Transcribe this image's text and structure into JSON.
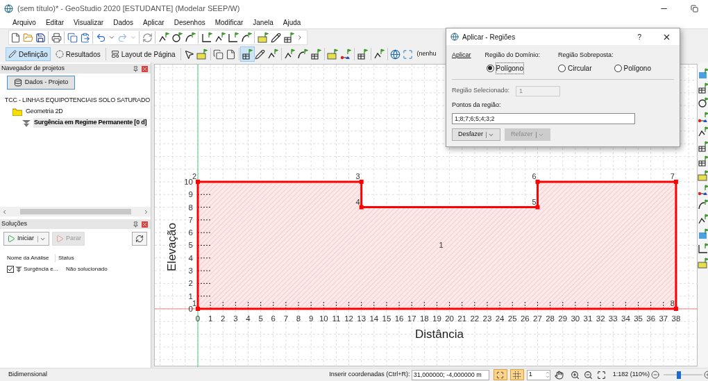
{
  "window": {
    "title": "(sem título)* - GeoStudio 2020 [ESTUDANTE] (Modelar SEEP/W)"
  },
  "menu": [
    "Arquivo",
    "Editar",
    "Visualizar",
    "Dados",
    "Aplicar",
    "Desenhos",
    "Modificar",
    "Janela",
    "Ajuda"
  ],
  "mode_tabs": [
    {
      "label": "Definição",
      "selected": true
    },
    {
      "label": "Resultados",
      "selected": false
    },
    {
      "label": "Layout de Página",
      "selected": false
    }
  ],
  "toolbar_text": "(nenhu",
  "project_navigator": {
    "title": "Navegador de projetos",
    "button": "Dados - Projeto",
    "tree": [
      {
        "label": "TCC - LINHAS EQUIPOTENCIAIS SOLO SATURADO",
        "selected": false,
        "children": [
          {
            "label": "Geometria 2D",
            "selected": false,
            "children": [
              {
                "label": "Surgência em Regime Permanente [0 d]",
                "selected": true
              }
            ]
          }
        ]
      }
    ]
  },
  "solutions": {
    "title": "Soluções",
    "buttons": [
      {
        "label": "Iniciar",
        "disabled": false
      },
      {
        "label": "Parar",
        "disabled": true
      }
    ],
    "columns": [
      "Nome da Análise",
      "Status"
    ],
    "rows": [
      {
        "checked": true,
        "name": "Surgência e...",
        "status": "Não solucionado"
      }
    ]
  },
  "canvas": {
    "chart_data": {
      "type": "area",
      "xlabel": "Distância",
      "ylabel": "Elevação",
      "x": [
        0,
        0,
        13,
        13,
        27,
        27,
        38,
        38,
        0
      ],
      "series": [
        {
          "color": "#ff0000",
          "values": [
            0,
            10,
            10,
            8,
            8,
            10,
            10,
            0,
            0
          ]
        }
      ],
      "xlim": [
        -3.42,
        39.77
      ],
      "ylim": [
        -4.59,
        19.23
      ],
      "grid": true,
      "xticks": [
        0,
        1,
        2,
        3,
        4,
        5,
        6,
        7,
        8,
        9,
        10,
        11,
        12,
        13,
        14,
        15,
        16,
        17,
        18,
        19,
        20,
        21,
        22,
        23,
        24,
        25,
        26,
        27,
        28,
        29,
        30,
        31,
        32,
        33,
        34,
        35,
        36,
        37,
        38
      ],
      "yticks": [
        0,
        1,
        2,
        3,
        4,
        5,
        6,
        7,
        8,
        9,
        10
      ],
      "annotations": [
        {
          "text": "1",
          "x": 0,
          "y": 0
        },
        {
          "text": "2",
          "x": 0,
          "y": 10
        },
        {
          "text": "3",
          "x": 13,
          "y": 10
        },
        {
          "text": "4",
          "x": 13,
          "y": 8
        },
        {
          "text": "5",
          "x": 27,
          "y": 8
        },
        {
          "text": "6",
          "x": 27,
          "y": 10
        },
        {
          "text": "7",
          "x": 38,
          "y": 10
        },
        {
          "text": "8",
          "x": 38,
          "y": 0
        }
      ]
    },
    "region_label": "1"
  },
  "dialog": {
    "title": "Aplicar - Regiões",
    "help": "?",
    "apply_label": "Aplicar",
    "domain_label": "Região do Domínio:",
    "domain_options": [
      {
        "label": "Polígono",
        "selected": true
      }
    ],
    "overlay_label": "Região Sobreposta:",
    "overlay_options": [
      {
        "label": "Circular",
        "selected": false
      },
      {
        "label": "Polígono",
        "selected": false
      }
    ],
    "selected_region": {
      "label": "Região Selecionado:",
      "value": "1",
      "disabled": true
    },
    "points": {
      "label": "Pontos da região:",
      "value": "1;8;7;6;5;4;3;2"
    },
    "buttons": [
      {
        "label": "Desfazer",
        "disabled": false
      },
      {
        "label": "Refazer",
        "disabled": true
      }
    ]
  },
  "status_bar": {
    "mode": "Bidimensional",
    "coord_label": "Inserir coordenadas (Ctrl+R):",
    "coord_value": "31,000000; -4,000000 m",
    "snap_on": true,
    "grid_on": true,
    "spin_value": "1",
    "scale": "1:182 (110%)",
    "zoom": {
      "level": 0.4
    }
  }
}
